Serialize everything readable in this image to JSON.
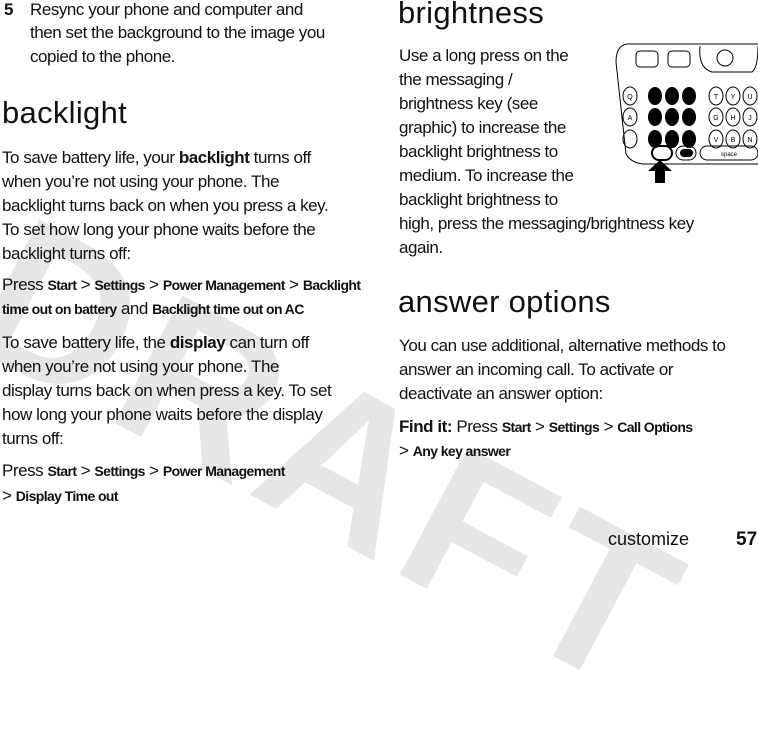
{
  "watermark": "DRAFT",
  "left": {
    "step_number": "5",
    "step_lines": [
      "Resync your phone and computer and",
      "then set the background to the image you",
      "copied to the phone."
    ],
    "backlight_heading": "backlight",
    "p1": {
      "l1a": "To save battery life, your ",
      "l1b": "backlight",
      "l1c": " turns off",
      "l2": "when you’re not using your phone. The",
      "l3": "backlight turns back on when you press a key.",
      "l4": "To set how long your phone waits before the",
      "l5": "backlight turns off:"
    },
    "press1": {
      "press": "Press ",
      "start": "Start",
      "sep": " > ",
      "settings": "Settings",
      "power": "Power Management",
      "backlight_bat_1": "Backlight",
      "backlight_bat_2": "time out on battery",
      "and": " and ",
      "backlight_ac": "Backlight time out on AC"
    },
    "p2": {
      "l1a": "To save battery life, the ",
      "l1b": "display",
      "l1c": " can turn off",
      "l2": "when you’re not using your phone. The",
      "l3": "display turns back on when press a key. To set",
      "l4": "how long your phone waits before the display",
      "l5": "turns off:"
    },
    "press2": {
      "press": "Press ",
      "start": "Start",
      "sep": " > ",
      "settings": "Settings",
      "power": "Power Management",
      "sep2": "> ",
      "display": "Display Time out"
    }
  },
  "right": {
    "brightness_heading": "brightness",
    "p_lines": [
      "Use a long press on the",
      "the messaging /",
      "brightness key (see",
      "graphic) to increase the",
      "backlight brightness to",
      "medium. To increase the",
      "backlight brightness to",
      "high, press the messaging/brightness key",
      "again."
    ],
    "answer_heading": "answer options",
    "a_lines": [
      "You can use additional, alternative methods to",
      "answer an incoming call. To activate or",
      "deactivate an answer option:"
    ],
    "find": {
      "label": "Find it:",
      "press": " Press ",
      "start": "Start",
      "sep": " > ",
      "call": "Call Options",
      "sep2": "> ",
      "any": "Any key answer"
    },
    "keyboard": {
      "space": "space",
      "keys": [
        "Q",
        "A",
        "T",
        "Y",
        "U",
        "G",
        "H",
        "J",
        "V",
        "B",
        "N"
      ]
    }
  },
  "footer": {
    "section": "customize",
    "page": "57"
  }
}
